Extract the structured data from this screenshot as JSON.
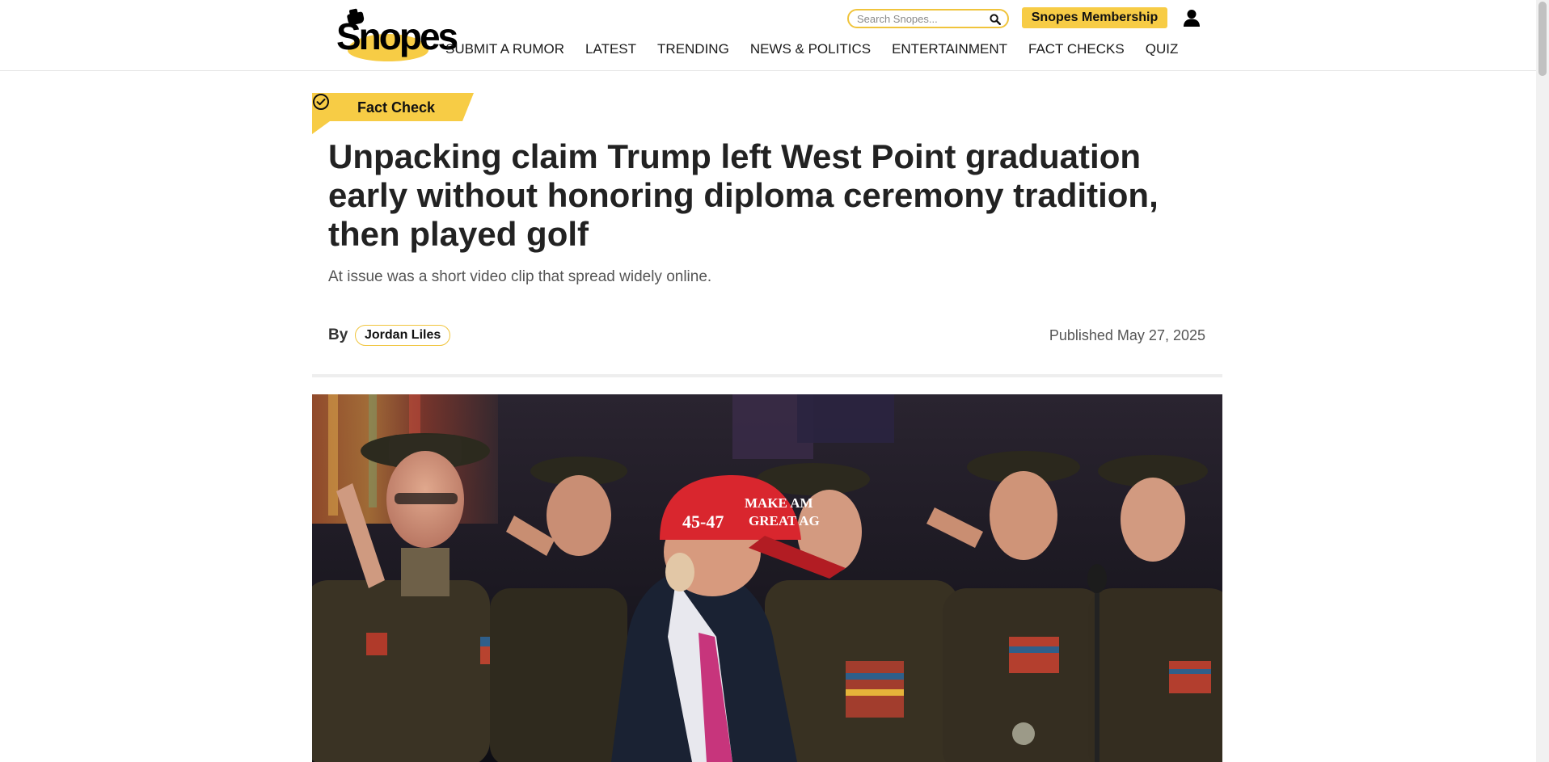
{
  "header": {
    "logo_text": "Snopes",
    "search_placeholder": "Search Snopes...",
    "membership_label": "Snopes Membership",
    "nav": [
      "SUBMIT A RUMOR",
      "LATEST",
      "TRENDING",
      "NEWS & POLITICS",
      "ENTERTAINMENT",
      "FACT CHECKS",
      "QUIZ"
    ]
  },
  "article": {
    "badge": "Fact Check",
    "headline": "Unpacking claim Trump left West Point graduation early without honoring diploma ceremony tradition, then played golf",
    "subhead": "At issue was a short video clip that spread widely online.",
    "byline_label": "By",
    "author": "Jordan Liles",
    "published_label": "Published",
    "published_date": "May 27, 2025"
  },
  "hero_image": {
    "cap_text_line1": "MAKE AM",
    "cap_text_line2": "GREAT AG",
    "cap_number": "45-47"
  },
  "colors": {
    "accent": "#f7cc45",
    "accent_border": "#f0c43c",
    "headline": "#222222",
    "muted": "#555555"
  }
}
